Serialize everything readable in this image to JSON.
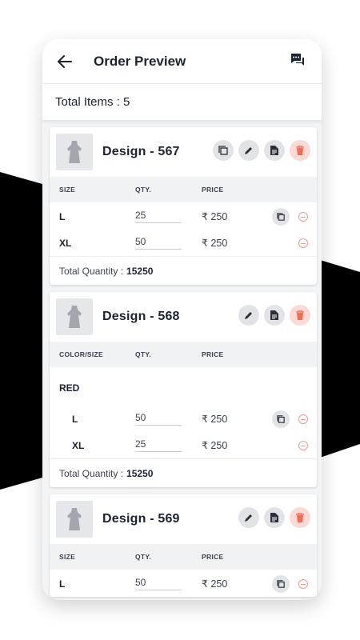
{
  "app": {
    "title": "Order Preview"
  },
  "summary": {
    "total_items_label": "Total Items : 5"
  },
  "colors": {
    "accent_delete": "#f26b55",
    "icon_gray": "#2a2f3a"
  },
  "columns": {
    "qty": "QTY.",
    "price": "PRICE"
  },
  "cards": [
    {
      "name": "Design - 567",
      "first_col": "SIZE",
      "rows": [
        {
          "size": "L",
          "qty": "25",
          "price": "₹ 250",
          "copy": true
        },
        {
          "size": "XL",
          "qty": "50",
          "price": "₹ 250",
          "copy": false
        }
      ],
      "total_label": "Total Quantity :",
      "total_value": "15250"
    },
    {
      "name": "Design - 568",
      "first_col": "COLOR/SIZE",
      "group": "RED",
      "rows": [
        {
          "size": "L",
          "qty": "50",
          "price": "₹ 250",
          "copy": true
        },
        {
          "size": "XL",
          "qty": "25",
          "price": "₹ 250",
          "copy": false
        }
      ],
      "total_label": "Total Quantity :",
      "total_value": "15250"
    },
    {
      "name": "Design - 569",
      "first_col": "SIZE",
      "rows": [
        {
          "size": "L",
          "qty": "50",
          "price": "₹ 250",
          "copy": true
        }
      ]
    }
  ]
}
